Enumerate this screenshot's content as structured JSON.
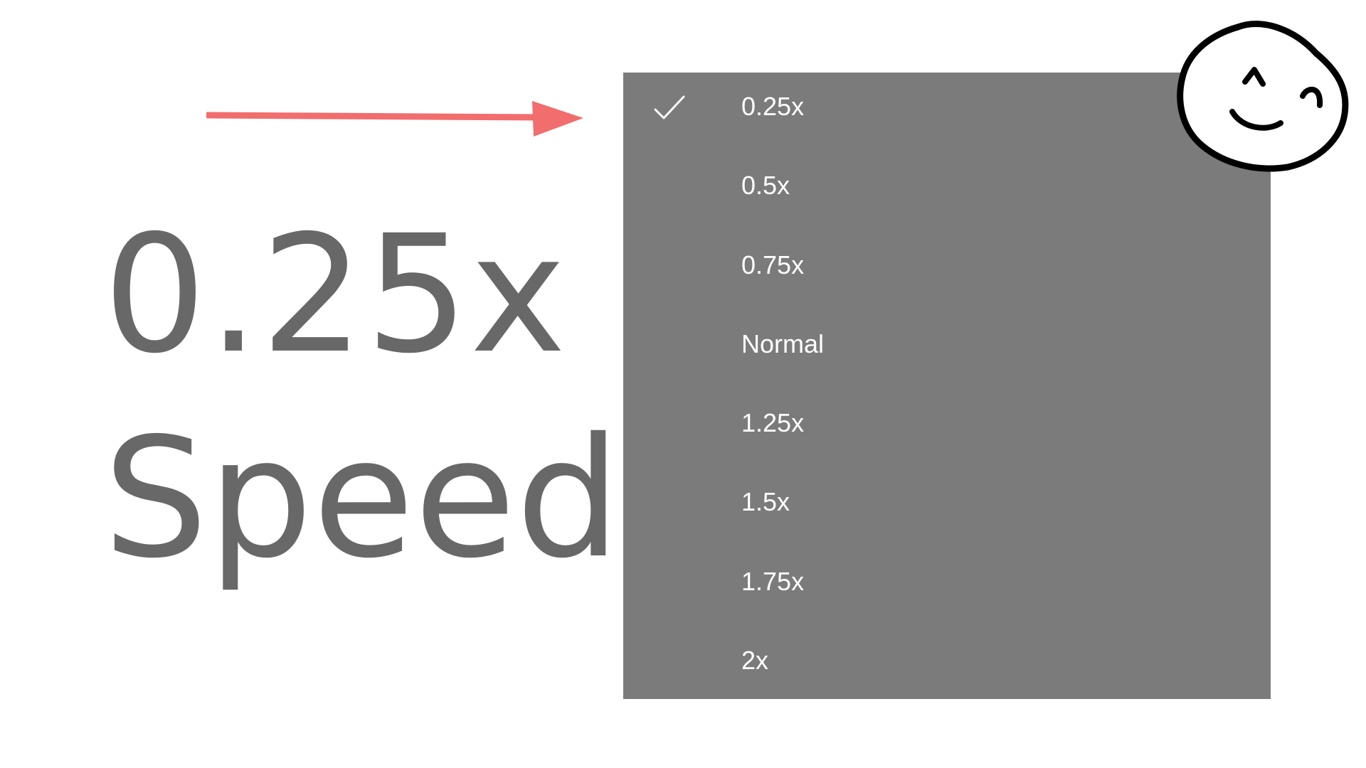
{
  "overlay": {
    "speed_value": "0.25x",
    "speed_word": "Speed",
    "arrow_color": "#f26d6d"
  },
  "speed_menu": {
    "selected_index": 0,
    "background_color": "#7b7b7b",
    "check_icon": "checkmark-icon",
    "items": [
      {
        "label": "0.25x"
      },
      {
        "label": "0.5x"
      },
      {
        "label": "0.75x"
      },
      {
        "label": "Normal"
      },
      {
        "label": "1.25x"
      },
      {
        "label": "1.5x"
      },
      {
        "label": "1.75x"
      },
      {
        "label": "2x"
      }
    ]
  },
  "doodle": {
    "icon": "smiley-face-doodle"
  }
}
